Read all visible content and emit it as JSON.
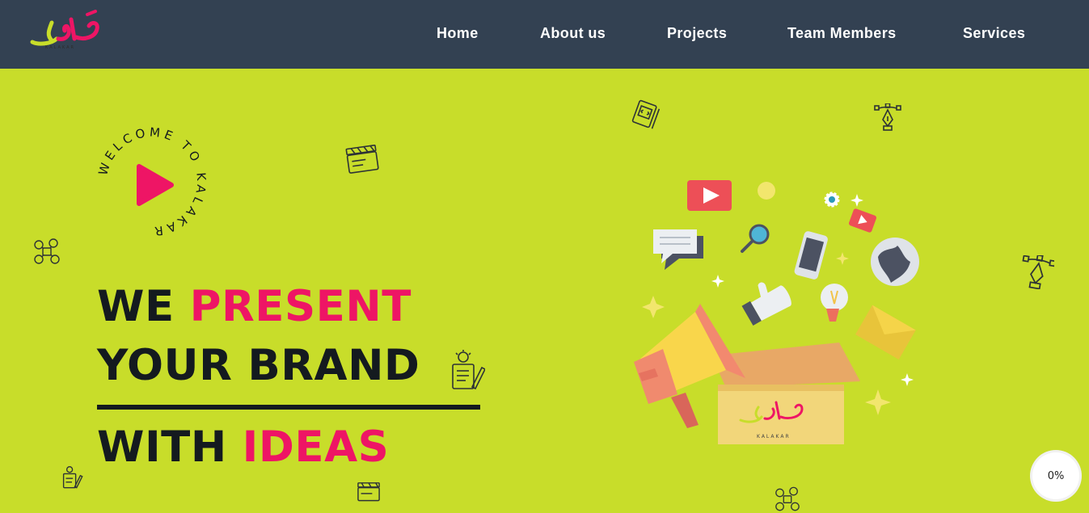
{
  "header": {
    "logo_text": "KALAKAR",
    "nav": [
      {
        "label": "Home"
      },
      {
        "label": "About us"
      },
      {
        "label": "Projects"
      },
      {
        "label": "Team Members"
      },
      {
        "label": "Services"
      }
    ]
  },
  "hero": {
    "badge_text": "WELCOME TO KALAKAR",
    "line1_dark": "WE",
    "line1_pink": "PRESENT",
    "line2": "YOUR BRAND",
    "line3_dark": "WITH",
    "line3_pink": "IDEAS"
  },
  "illustration": {
    "box_logo_text": "KALAKAR"
  },
  "progress": {
    "label": "0%"
  },
  "colors": {
    "header_bg": "#334152",
    "hero_bg": "#c8dd2a",
    "accent_pink": "#ee1565",
    "text_dark": "#141a1f"
  }
}
